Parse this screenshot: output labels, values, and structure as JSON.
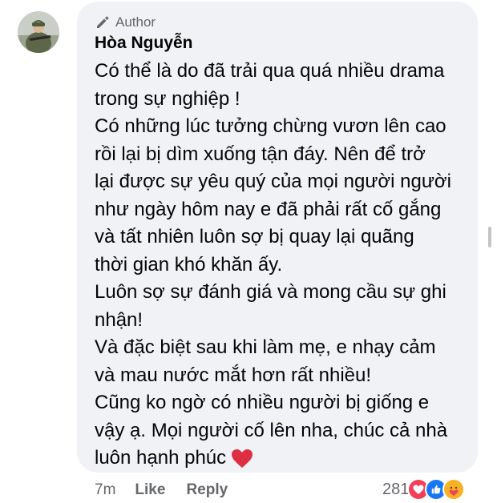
{
  "comment": {
    "author_badge": "Author",
    "author_name": "Hòa Nguyễn",
    "lines": [
      "Có thể là do đã trải qua quá nhiều drama",
      "trong sự nghiệp !",
      "Có những lúc tưởng chừng vươn lên cao",
      "rồi lại bị dìm xuống tận đáy. Nên để trở",
      "lại được sự yêu quý của mọi người người",
      "như ngày hôm nay e đã phải rất cố gắng",
      "và tất nhiên luôn sợ bị quay lại quãng",
      "thời gian khó khăn ấy.",
      "Luôn sợ sự đánh giá và mong cầu sự ghi",
      "nhận!",
      "Và đặc biệt sau khi làm mẹ, e nhạy cảm",
      "và mau nước mắt hơn rất nhiều!",
      "Cũng ko ngờ có nhiều người bị giống e",
      "vậy ạ. Mọi người cố lên nha, chúc cả nhà",
      "luôn hạnh phúc"
    ],
    "heart_icon": "red-heart-emoji"
  },
  "footer": {
    "time": "7m",
    "like_label": "Like",
    "reply_label": "Reply",
    "reaction_count": "281",
    "reactions": [
      "love",
      "like",
      "care"
    ]
  },
  "colors": {
    "bubble": "#f0f2f5",
    "meta_text": "#65676b",
    "love": "#f33e58",
    "like": "#1877f2",
    "care": "#f7b125"
  }
}
